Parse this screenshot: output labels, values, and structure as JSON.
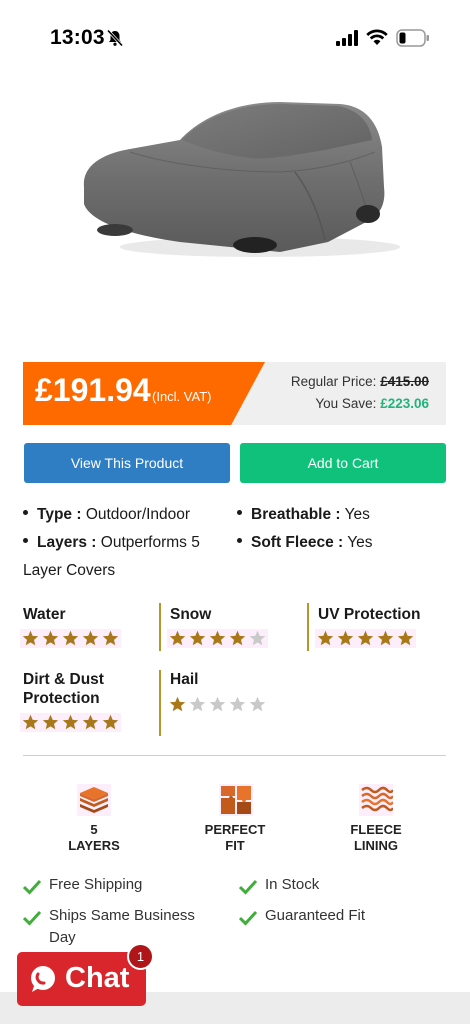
{
  "status_bar": {
    "time": "13:03"
  },
  "product": {
    "image_alt": "Grey outdoor car cover"
  },
  "price": {
    "current": "£191.94",
    "vat_note": "(Incl. VAT)",
    "regular_label": "Regular Price:",
    "regular_value": "£415.00",
    "save_label": "You Save:",
    "save_value": "£223.06",
    "accent_color": "#ff6a00",
    "save_color": "#1fb57a"
  },
  "buttons": {
    "view": "View This Product",
    "cart": "Add to Cart"
  },
  "specs": {
    "type_label": "Type :",
    "type_value": "Outdoor/Indoor",
    "breathable_label": "Breathable :",
    "breathable_value": "Yes",
    "layers_label": "Layers :",
    "layers_value": "Outperforms 5",
    "layers_value_cont": "Layer Covers",
    "fleece_label": "Soft Fleece :",
    "fleece_value": "Yes"
  },
  "ratings": [
    {
      "label": "Water",
      "stars": 5
    },
    {
      "label": "Snow",
      "stars": 4
    },
    {
      "label": "UV Protection",
      "stars": 5
    },
    {
      "label": "Dirt & Dust Protection",
      "stars": 5
    },
    {
      "label": "Hail",
      "stars": 1
    }
  ],
  "features": [
    {
      "line1": "5",
      "line2": "LAYERS",
      "icon": "layers-icon"
    },
    {
      "line1": "PERFECT",
      "line2": "FIT",
      "icon": "puzzle-icon"
    },
    {
      "line1": "FLEECE",
      "line2": "LINING",
      "icon": "fleece-icon"
    }
  ],
  "checklist": {
    "free_shipping": "Free Shipping",
    "in_stock": "In Stock",
    "ships_line1": "Ships Same Business",
    "ships_line2": "Day",
    "guaranteed": "Guaranteed Fit"
  },
  "chat": {
    "label": "Chat",
    "badge": "1",
    "color": "#d8262c"
  }
}
